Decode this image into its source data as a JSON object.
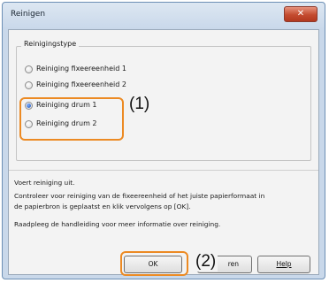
{
  "window": {
    "title": "Reinigen",
    "close_label": "✕"
  },
  "group": {
    "label": "Reinigingstype",
    "options": [
      {
        "label": "Reiniging fixeereenheid 1",
        "selected": false
      },
      {
        "label": "Reiniging fixeereenheid 2",
        "selected": false
      },
      {
        "label": "Reiniging drum 1",
        "selected": true
      },
      {
        "label": "Reiniging drum 2",
        "selected": false
      }
    ]
  },
  "description": {
    "line1": "Voert reiniging uit.",
    "line2": "Controleer voor reiniging van de fixeereenheid of het juiste papierformaat in",
    "line3": "de papierbron is geplaatst en klik vervolgens op [OK].",
    "line4": "Raadpleeg de handleiding voor meer informatie over reiniging."
  },
  "buttons": {
    "ok": "OK",
    "annuleren": "ren",
    "help": "Help"
  },
  "callouts": {
    "one": "(1)",
    "two": "(2)"
  },
  "colors": {
    "highlight": "#ec8a23",
    "close_button": "#c44b30"
  }
}
